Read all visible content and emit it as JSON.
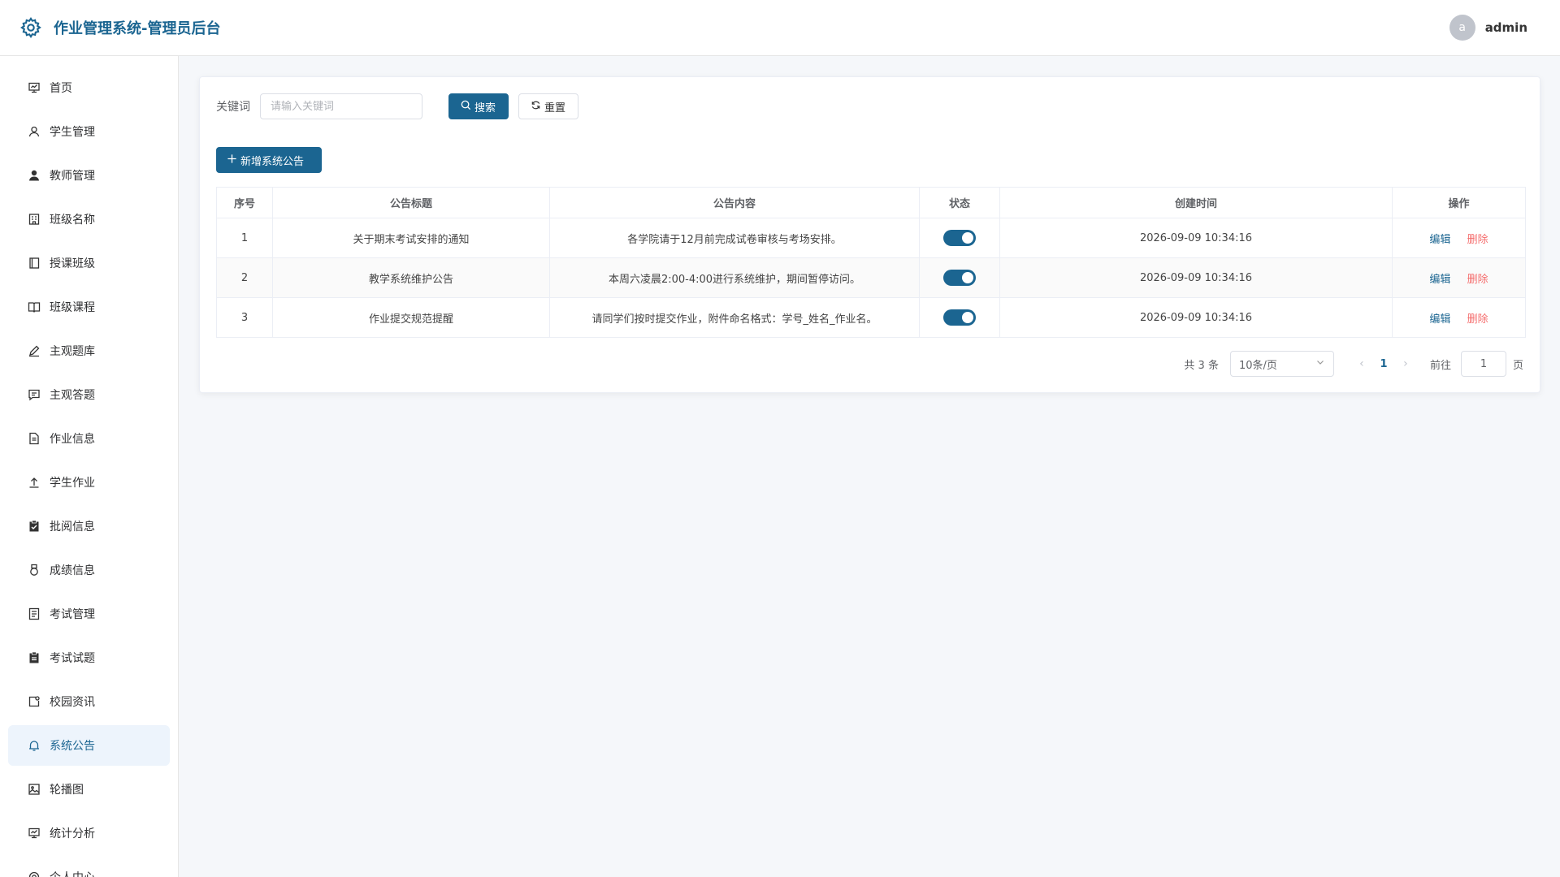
{
  "header": {
    "title": "作业管理系统-管理员后台",
    "avatar_letter": "a",
    "username": "admin"
  },
  "sidebar": {
    "items": [
      {
        "label": "首页",
        "icon": "home-icon"
      },
      {
        "label": "学生管理",
        "icon": "user-icon"
      },
      {
        "label": "教师管理",
        "icon": "teacher-icon"
      },
      {
        "label": "班级名称",
        "icon": "building-icon"
      },
      {
        "label": "授课班级",
        "icon": "notebook-icon"
      },
      {
        "label": "班级课程",
        "icon": "book-icon"
      },
      {
        "label": "主观题库",
        "icon": "edit-icon"
      },
      {
        "label": "主观答题",
        "icon": "message-icon"
      },
      {
        "label": "作业信息",
        "icon": "document-icon"
      },
      {
        "label": "学生作业",
        "icon": "upload-icon"
      },
      {
        "label": "批阅信息",
        "icon": "checklist-icon"
      },
      {
        "label": "成绩信息",
        "icon": "medal-icon"
      },
      {
        "label": "考试管理",
        "icon": "tickets-icon"
      },
      {
        "label": "考试试题",
        "icon": "clipboard-icon"
      },
      {
        "label": "校园资讯",
        "icon": "news-icon"
      },
      {
        "label": "系统公告",
        "icon": "bell-icon"
      },
      {
        "label": "轮播图",
        "icon": "picture-icon"
      },
      {
        "label": "统计分析",
        "icon": "chart-icon"
      },
      {
        "label": "个人中心",
        "icon": "settings-icon"
      }
    ],
    "active_index": 15
  },
  "search": {
    "label": "关键词",
    "placeholder": "请输入关键词",
    "value": "",
    "search_button": "搜索",
    "reset_button": "重置"
  },
  "add_button": "新增系统公告",
  "table": {
    "headers": [
      "序号",
      "公告标题",
      "公告内容",
      "状态",
      "创建时间",
      "操作"
    ],
    "rows": [
      {
        "index": "1",
        "title": "关于期末考试安排的通知",
        "content": "各学院请于12月前完成试卷审核与考场安排。",
        "status": true,
        "created": "2026-09-09 10:34:16"
      },
      {
        "index": "2",
        "title": "教学系统维护公告",
        "content": "本周六凌晨2:00-4:00进行系统维护，期间暂停访问。",
        "status": true,
        "created": "2026-09-09 10:34:16"
      },
      {
        "index": "3",
        "title": "作业提交规范提醒",
        "content": "请同学们按时提交作业，附件命名格式：学号_姓名_作业名。",
        "status": true,
        "created": "2026-09-09 10:34:16"
      }
    ],
    "edit_label": "编辑",
    "delete_label": "删除"
  },
  "pagination": {
    "total_text": "共 3 条",
    "page_size": "10条/页",
    "current_page": "1",
    "goto_label": "前往",
    "goto_value": "1",
    "page_unit": "页"
  },
  "colors": {
    "primary": "#1b6591",
    "danger": "#f56c6c",
    "active_bg": "#edf4fc"
  }
}
